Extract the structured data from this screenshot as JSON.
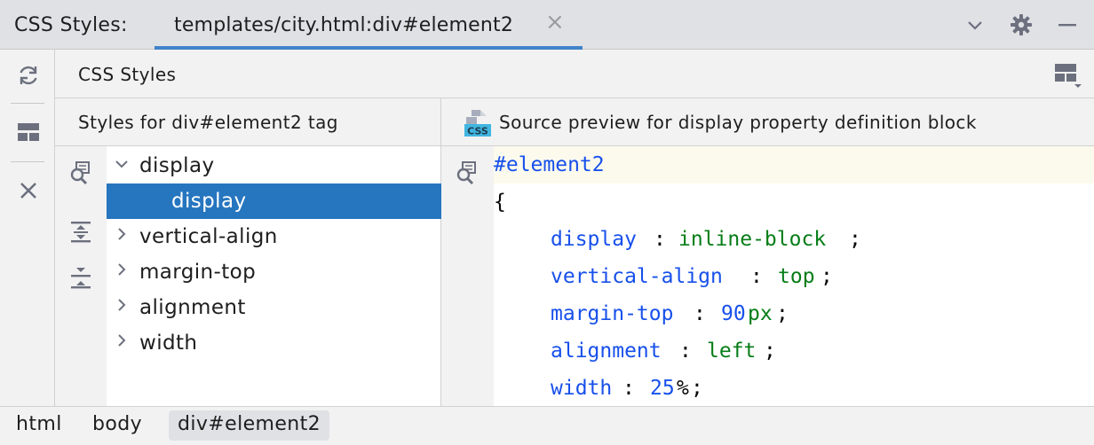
{
  "toolwindow": {
    "title": "CSS Styles:",
    "tab_label": "templates/city.html:div#element2",
    "tab_close": "×",
    "accent_color": "#4083c9"
  },
  "subheader": {
    "title": "CSS Styles"
  },
  "left_pane": {
    "title": "Styles for div#element2 tag",
    "tree": [
      {
        "label": "display",
        "expanded": true
      },
      {
        "label": "display",
        "child": true,
        "selected": true
      },
      {
        "label": "vertical-align",
        "expanded": false
      },
      {
        "label": "margin-top",
        "expanded": false
      },
      {
        "label": "alignment",
        "expanded": false
      },
      {
        "label": "width",
        "expanded": false
      }
    ]
  },
  "right_pane": {
    "title": "Source preview for display property definition block",
    "file_badge": "CSS",
    "code": {
      "selector": "#element2",
      "open_brace": "{",
      "declarations": [
        {
          "prop": "display",
          "colon": ":",
          "value": "inline-block",
          "semi": ";"
        },
        {
          "prop": "vertical-align",
          "colon": ":",
          "value": "top",
          "semi": ";"
        },
        {
          "prop": "margin-top",
          "colon": ":",
          "num": "90",
          "unit": "px",
          "semi": ";"
        },
        {
          "prop": "alignment",
          "colon": ":",
          "value": "left",
          "semi": ";"
        },
        {
          "prop": "width",
          "colon": ":",
          "num": "25",
          "unit": "%",
          "semi": ";"
        }
      ]
    }
  },
  "breadcrumbs": [
    "html",
    "body",
    "div#element2"
  ],
  "icons": {
    "titlebar": [
      "chevron-down-icon",
      "gear-icon",
      "minimize-icon"
    ],
    "leftbar": [
      "refresh-icon",
      "layout-icon",
      "close-icon"
    ],
    "tree_tools": [
      "find-usages-icon",
      "expand-all-icon",
      "collapse-all-icon"
    ],
    "code_tools": [
      "find-usages-icon"
    ]
  }
}
